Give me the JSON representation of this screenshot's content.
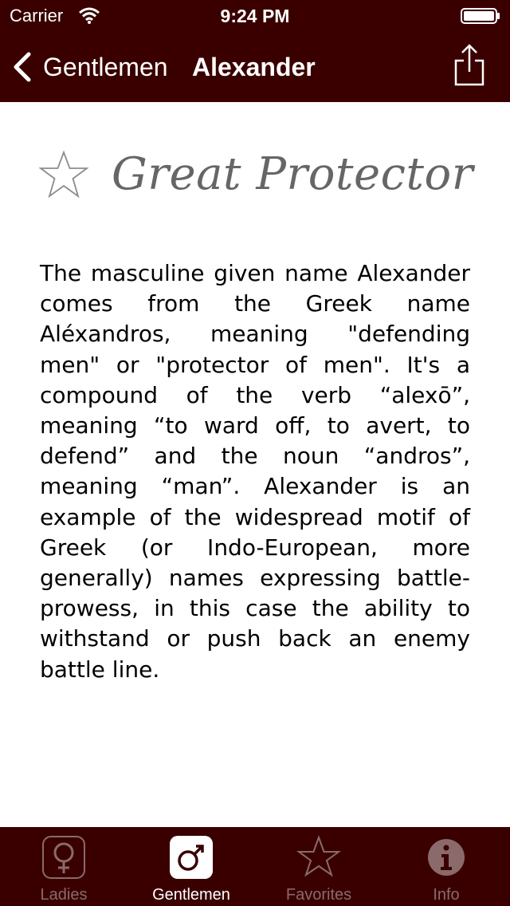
{
  "status_bar": {
    "carrier": "Carrier",
    "time": "9:24 PM"
  },
  "nav": {
    "back_label": "Gentlemen",
    "title": "Alexander"
  },
  "name_detail": {
    "meaning": "Great Protector",
    "description": "The masculine given name Alexander comes from the Greek name Aléxandros, meaning \"defending men\" or \"protector of men\". It's a compound of the verb “alexō”, meaning “to ward off, to avert, to defend” and the noun “andros”, meaning “man”. Alexander is an example of the widespread motif of Greek (or Indo-European, more generally) names expressing battle-prowess, in this case the ability to withstand or push back an enemy battle line."
  },
  "tabs": [
    {
      "label": "Ladies",
      "icon": "female-icon",
      "active": false
    },
    {
      "label": "Gentlemen",
      "icon": "male-icon",
      "active": true
    },
    {
      "label": "Favorites",
      "icon": "star-icon",
      "active": false
    },
    {
      "label": "Info",
      "icon": "info-icon",
      "active": false
    }
  ],
  "colors": {
    "bar_background": "#3a0000",
    "inactive_tab": "#8a6a6a",
    "title_text": "#666666"
  }
}
